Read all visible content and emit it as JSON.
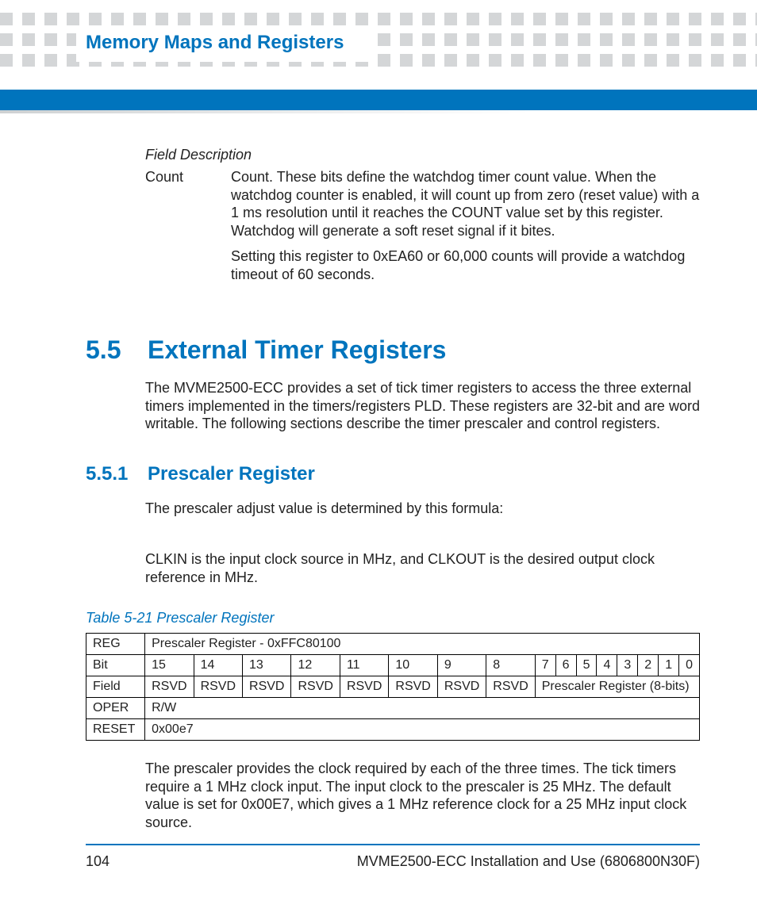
{
  "header": {
    "chapter_title": "Memory Maps and Registers"
  },
  "field_description": {
    "label": "Field Description",
    "rows": [
      {
        "term": "Count",
        "paragraphs": [
          "Count. These bits define the watchdog timer count value. When the watchdog counter is enabled, it will count up from zero (reset value) with a 1 ms resolution until it reaches the COUNT value set by this register. Watchdog will generate a soft reset signal if it bites.",
          "Setting this register to 0xEA60 or 60,000 counts will provide a watchdog timeout of 60 seconds."
        ]
      }
    ]
  },
  "section": {
    "number": "5.5",
    "title": "External Timer Registers",
    "intro": "The MVME2500-ECC provides a set of tick timer registers to access the three external timers implemented in the timers/registers PLD. These registers are 32-bit and are word writable. The following sections describe the timer prescaler and control registers."
  },
  "subsection": {
    "number": "5.5.1",
    "title": "Prescaler Register",
    "para1": "The prescaler adjust value is determined by this formula:",
    "para2": "CLKIN is the input clock source in MHz, and CLKOUT is the desired output clock reference in MHz."
  },
  "table": {
    "caption": "Table 5-21 Prescaler Register",
    "rows": {
      "reg_label": "REG",
      "reg_value": "Prescaler Register - 0xFFC80100",
      "bit_label": "Bit",
      "bits": [
        "15",
        "14",
        "13",
        "12",
        "11",
        "10",
        "9",
        "8",
        "7",
        "6",
        "5",
        "4",
        "3",
        "2",
        "1",
        "0"
      ],
      "field_label": "Field",
      "fields_rsvd": [
        "RSVD",
        "RSVD",
        "RSVD",
        "RSVD",
        "RSVD",
        "RSVD",
        "RSVD",
        "RSVD"
      ],
      "field_span": "Prescaler Register (8-bits)",
      "oper_label": "OPER",
      "oper_value": "R/W",
      "reset_label": "RESET",
      "reset_value": "0x00e7"
    }
  },
  "post_table_para": "The prescaler provides the clock required by each of the three times. The tick timers require a 1 MHz clock input. The input clock to the prescaler is 25 MHz. The default value is set for 0x00E7, which gives a 1 MHz reference clock for a 25 MHz input clock source.",
  "footer": {
    "page_number": "104",
    "doc_title": "MVME2500-ECC Installation and Use (6806800N30F)"
  }
}
